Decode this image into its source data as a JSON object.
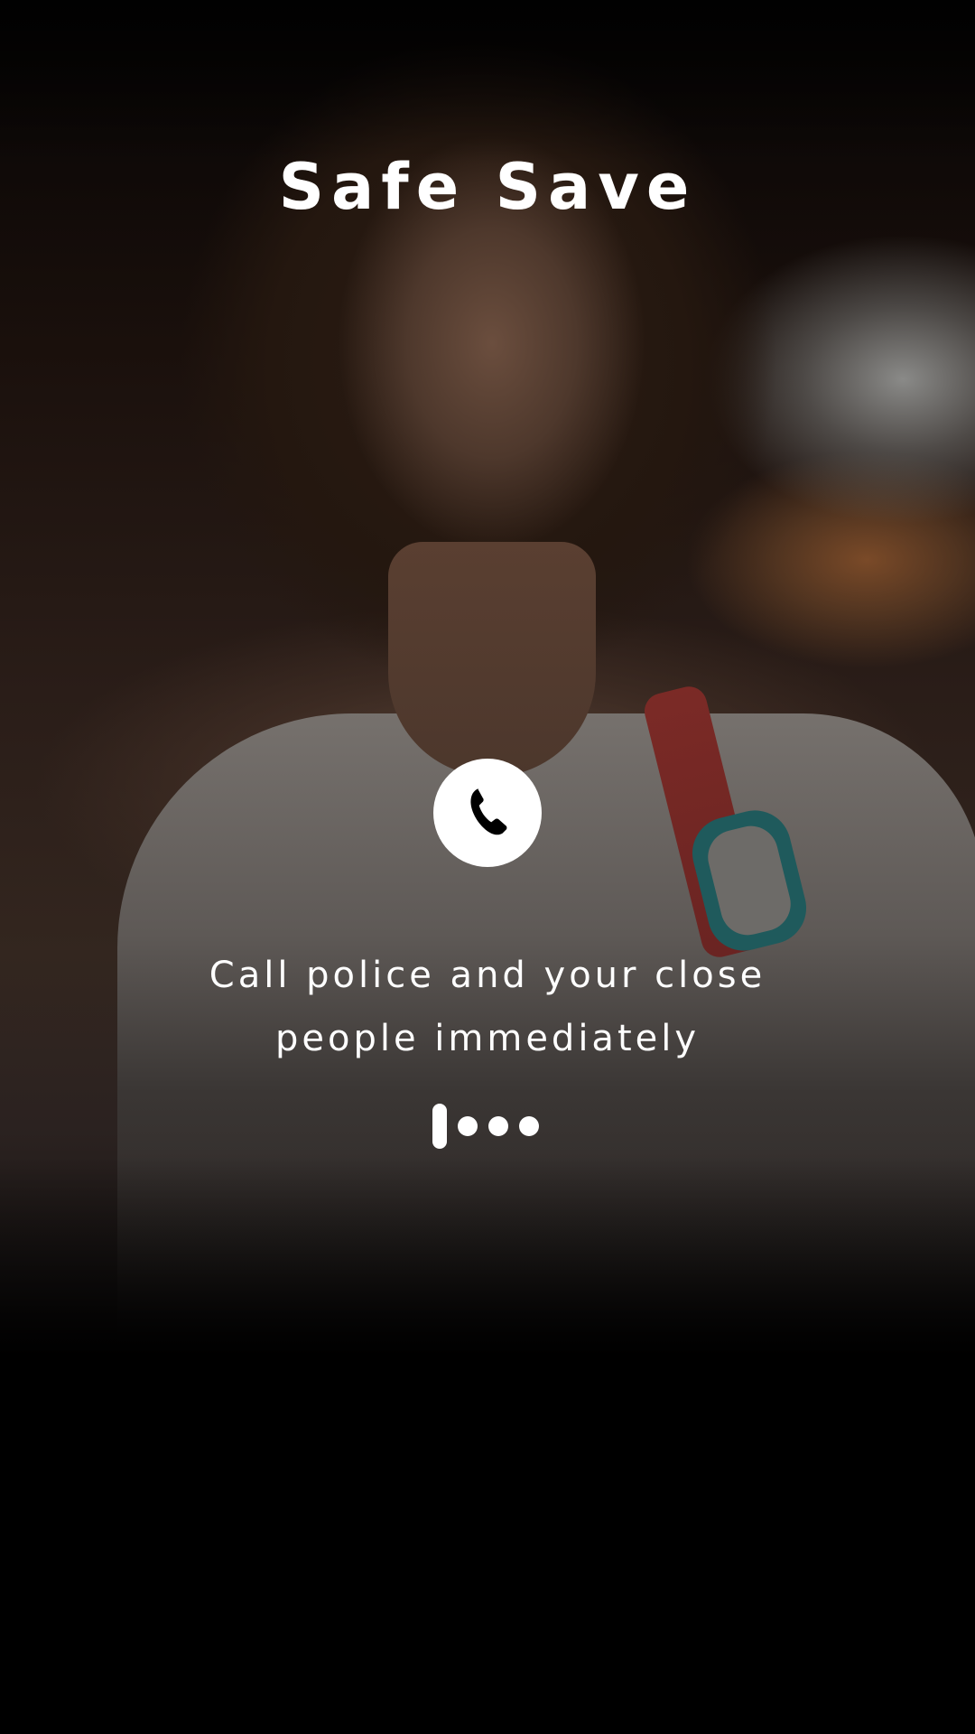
{
  "app": {
    "title": "Safe Save"
  },
  "call": {
    "icon": "phone-handset-icon",
    "message": "Call police and your close\npeople immediately"
  },
  "progress": {
    "indicators": [
      "bar",
      "dot",
      "dot",
      "dot"
    ],
    "active_index": 0
  },
  "colors": {
    "text": "#ffffff",
    "button_bg": "#ffffff",
    "icon": "#000000",
    "background": "#000000"
  }
}
